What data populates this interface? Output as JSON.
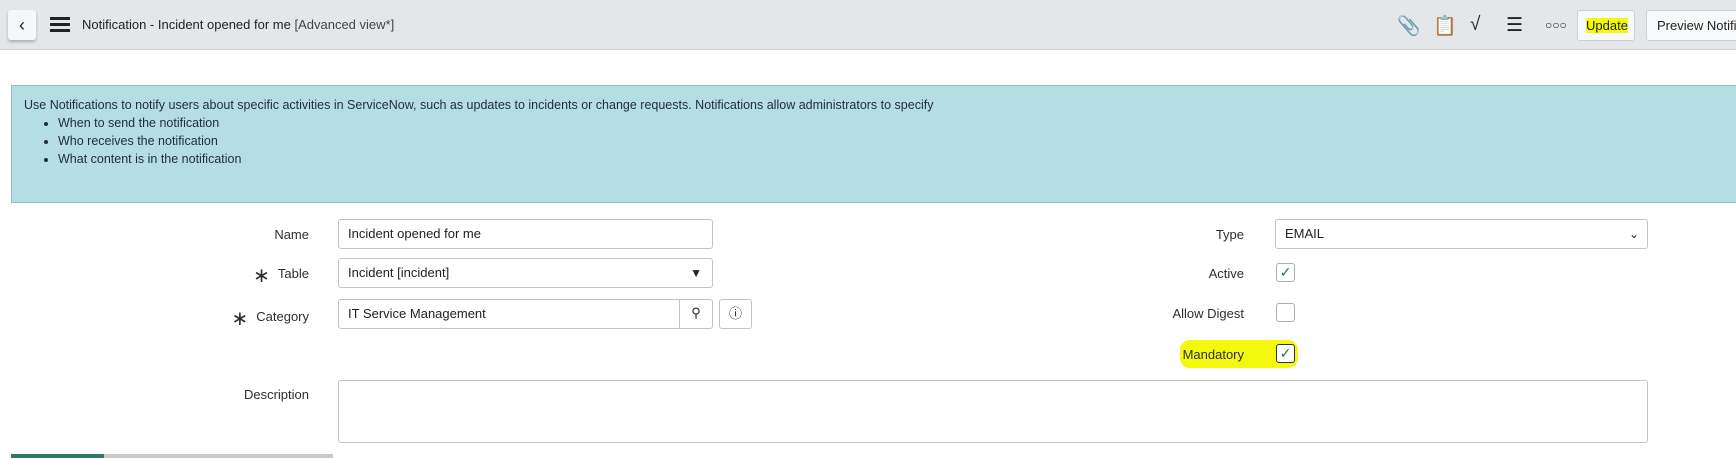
{
  "header": {
    "title": "Notification - Incident opened for me",
    "view": "[Advanced view*]",
    "update_label": "Update",
    "preview_label": "Preview Notific"
  },
  "info": {
    "text": "Use Notifications to notify users about specific activities in ServiceNow, such as updates to incidents or change requests. Notifications allow administrators to specify",
    "bullets": [
      "When to send the notification",
      "Who receives the notification",
      "What content is in the notification"
    ]
  },
  "form": {
    "name": {
      "label": "Name",
      "value": "Incident opened for me"
    },
    "table": {
      "label": "Table",
      "value": "Incident [incident]"
    },
    "category": {
      "label": "Category",
      "value": "IT Service Management"
    },
    "description": {
      "label": "Description",
      "value": ""
    },
    "type": {
      "label": "Type",
      "value": "EMAIL"
    },
    "active": {
      "label": "Active",
      "checked": true
    },
    "allow_digest": {
      "label": "Allow Digest",
      "checked": false
    },
    "mandatory": {
      "label": "Mandatory",
      "checked": true
    }
  },
  "colors": {
    "highlight": "#f4f80c",
    "info_bg": "#b5dde4",
    "accent": "#2a7a67"
  }
}
